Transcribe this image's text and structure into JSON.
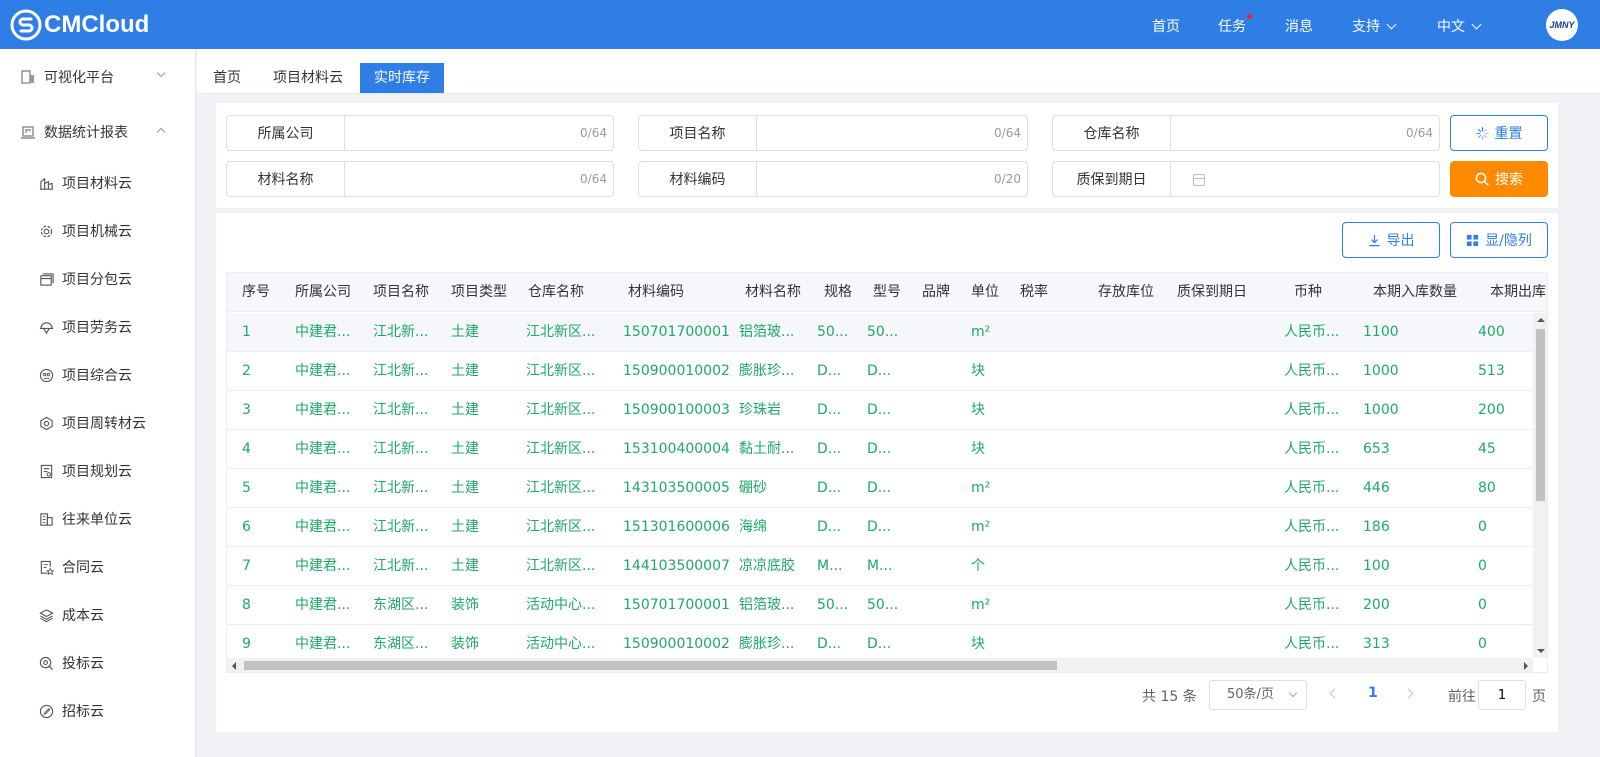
{
  "brand": {
    "name": "CMCloud",
    "avatar_text": "JMNY"
  },
  "topnav": {
    "home": "首页",
    "tasks": "任务",
    "messages": "消息",
    "support": "支持",
    "language": "中文"
  },
  "sidebar": {
    "groups": [
      {
        "label": "可视化平台",
        "icon": "monitor-icon",
        "expanded": false
      },
      {
        "label": "数据统计报表",
        "icon": "report-icon",
        "expanded": true
      }
    ],
    "items": [
      {
        "label": "项目材料云",
        "icon": "material-icon"
      },
      {
        "label": "项目机械云",
        "icon": "gear-icon"
      },
      {
        "label": "项目分包云",
        "icon": "subcontract-icon"
      },
      {
        "label": "项目劳务云",
        "icon": "helmet-icon"
      },
      {
        "label": "项目综合云",
        "icon": "integrated-icon"
      },
      {
        "label": "项目周转材云",
        "icon": "turnover-icon"
      },
      {
        "label": "项目规划云",
        "icon": "plan-icon"
      },
      {
        "label": "往来单位云",
        "icon": "building-icon"
      },
      {
        "label": "合同云",
        "icon": "contract-icon"
      },
      {
        "label": "成本云",
        "icon": "layers-icon"
      },
      {
        "label": "投标云",
        "icon": "bid-icon"
      },
      {
        "label": "招标云",
        "icon": "tender-icon"
      }
    ]
  },
  "tabs": [
    {
      "label": "首页",
      "active": false
    },
    {
      "label": "项目材料云",
      "active": false
    },
    {
      "label": "实时库存",
      "active": true
    }
  ],
  "filters": {
    "company": {
      "label": "所属公司",
      "value": "",
      "count": "0/64"
    },
    "project": {
      "label": "项目名称",
      "value": "",
      "count": "0/64"
    },
    "warehouse": {
      "label": "仓库名称",
      "value": "",
      "count": "0/64"
    },
    "material_name": {
      "label": "材料名称",
      "value": "",
      "count": "0/64"
    },
    "material_code": {
      "label": "材料编码",
      "value": "",
      "count": "0/20"
    },
    "warranty_date": {
      "label": "质保到期日",
      "value": ""
    }
  },
  "buttons": {
    "reset": "重置",
    "search": "搜索",
    "export": "导出",
    "columns": "显/隐列"
  },
  "colors": {
    "primary": "#2f7ee6",
    "search": "#ff8a00",
    "cell_text": "#20a866"
  },
  "table": {
    "columns": [
      "序号",
      "所属公司",
      "项目名称",
      "项目类型",
      "仓库名称",
      "材料编码",
      "材料名称",
      "规格",
      "型号",
      "品牌",
      "单位",
      "税率",
      "存放库位",
      "质保到期日",
      "币种",
      "本期入库数量",
      "本期出库"
    ],
    "rows": [
      [
        "1",
        "中建君...",
        "江北新...",
        "土建",
        "江北新区...",
        "150701700001",
        "铝箔玻...",
        "50...",
        "50...",
        "",
        "m²",
        "",
        "",
        "",
        "人民币...",
        "1100",
        "400"
      ],
      [
        "2",
        "中建君...",
        "江北新...",
        "土建",
        "江北新区...",
        "150900010002",
        "膨胀珍...",
        "D...",
        "D...",
        "",
        "块",
        "",
        "",
        "",
        "人民币...",
        "1000",
        "513"
      ],
      [
        "3",
        "中建君...",
        "江北新...",
        "土建",
        "江北新区...",
        "150900100003",
        "珍珠岩",
        "D...",
        "D...",
        "",
        "块",
        "",
        "",
        "",
        "人民币...",
        "1000",
        "200"
      ],
      [
        "4",
        "中建君...",
        "江北新...",
        "土建",
        "江北新区...",
        "153100400004",
        "黏土耐...",
        "D...",
        "D...",
        "",
        "块",
        "",
        "",
        "",
        "人民币...",
        "653",
        "45"
      ],
      [
        "5",
        "中建君...",
        "江北新...",
        "土建",
        "江北新区...",
        "143103500005",
        "硼砂",
        "D...",
        "D...",
        "",
        "m²",
        "",
        "",
        "",
        "人民币...",
        "446",
        "80"
      ],
      [
        "6",
        "中建君...",
        "江北新...",
        "土建",
        "江北新区...",
        "151301600006",
        "海绵",
        "D...",
        "D...",
        "",
        "m²",
        "",
        "",
        "",
        "人民币...",
        "186",
        "0"
      ],
      [
        "7",
        "中建君...",
        "江北新...",
        "土建",
        "江北新区...",
        "144103500007",
        "凉凉底胶",
        "M...",
        "M...",
        "",
        "个",
        "",
        "",
        "",
        "人民币...",
        "100",
        "0"
      ],
      [
        "8",
        "中建君...",
        "东湖区...",
        "装饰",
        "活动中心...",
        "150701700001",
        "铝箔玻...",
        "50...",
        "50...",
        "",
        "m²",
        "",
        "",
        "",
        "人民币...",
        "200",
        "0"
      ],
      [
        "9",
        "中建君...",
        "东湖区...",
        "装饰",
        "活动中心...",
        "150900010002",
        "膨胀珍...",
        "D...",
        "D...",
        "",
        "块",
        "",
        "",
        "",
        "人民币...",
        "313",
        "0"
      ]
    ]
  },
  "pagination": {
    "total": "共 15 条",
    "page_size": "50条/页",
    "current": "1",
    "goto_label": "前往",
    "goto_value": "1",
    "page_unit": "页"
  }
}
